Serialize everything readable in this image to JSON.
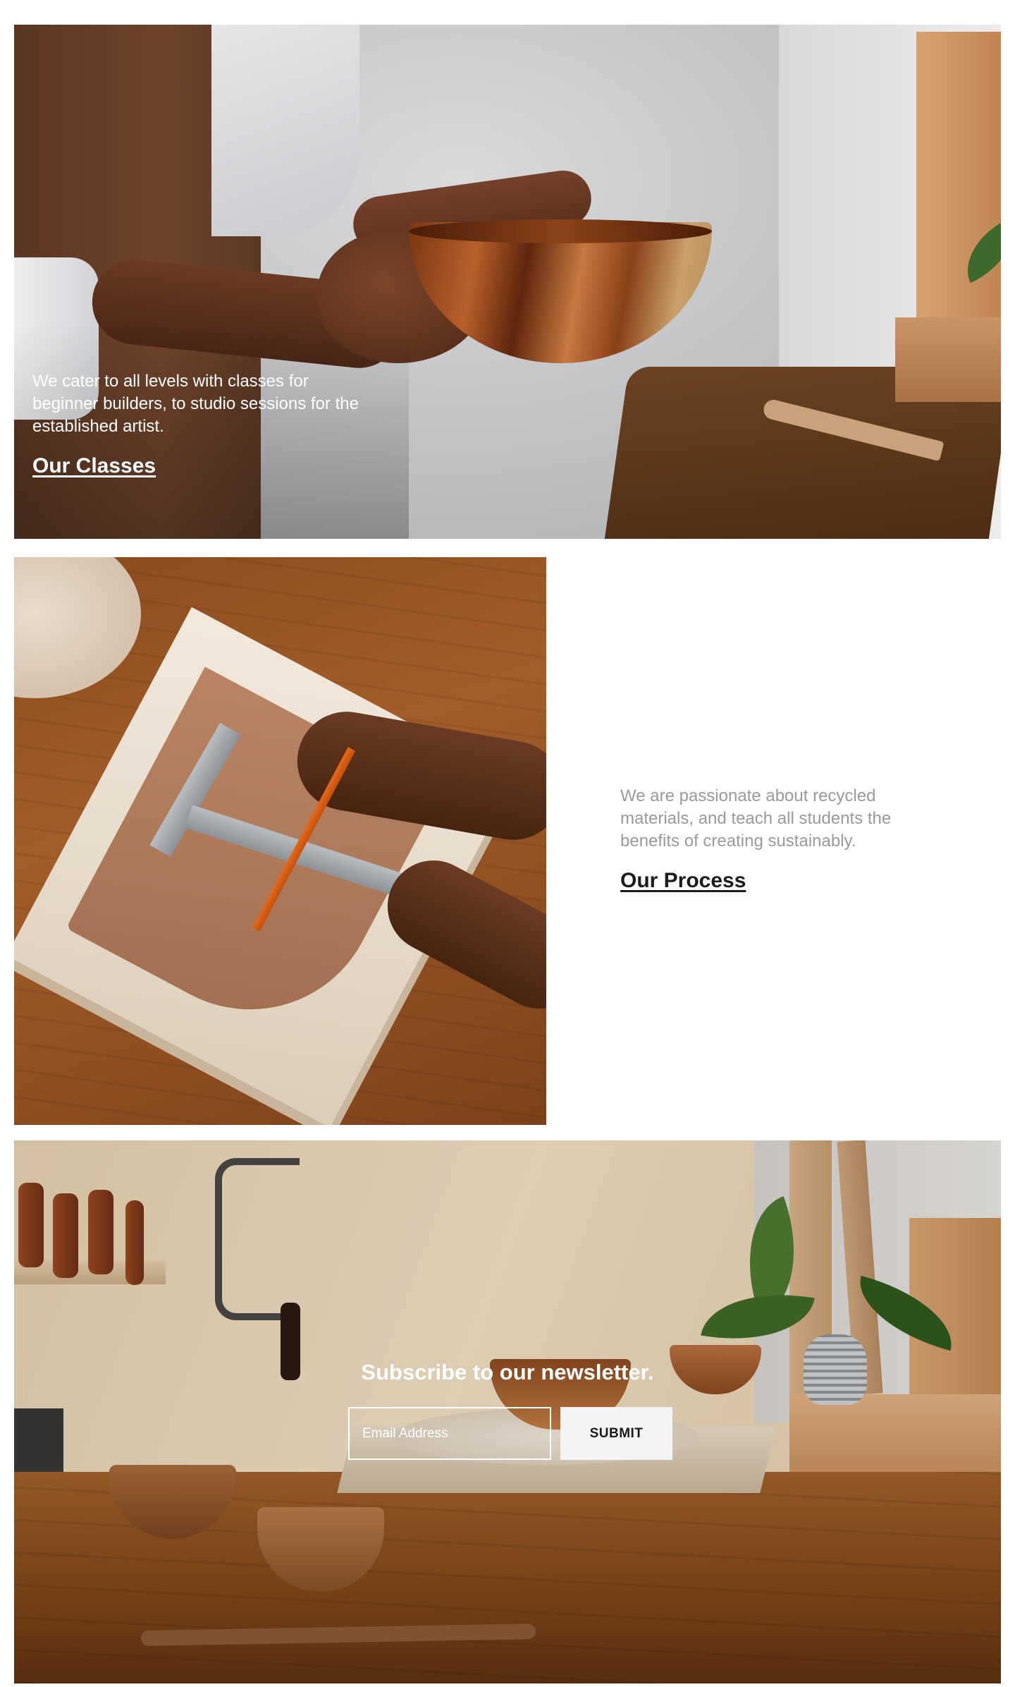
{
  "classes": {
    "text": "We cater to all levels with classes for beginner builders, to studio sessions for the established artist.",
    "link": "Our Classes"
  },
  "process": {
    "text": "We are passionate about recycled materials, and teach all students the benefits of creating sustainably.",
    "link": "Our Process"
  },
  "newsletter": {
    "title": "Subscribe to our newsletter.",
    "email_placeholder": "Email Address",
    "submit_label": "SUBMIT"
  },
  "colors": {
    "body_text_muted": "#9a9a9a",
    "link_dark": "#1c1c1c",
    "button_bg": "#f4f4f4"
  }
}
